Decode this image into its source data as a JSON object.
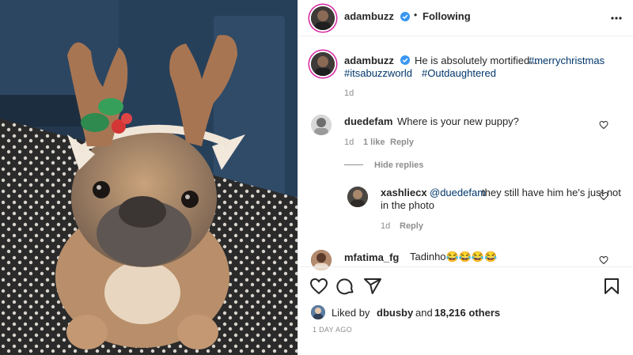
{
  "post": {
    "image_alt": "French bulldog wearing reindeer antlers headband",
    "author": "adambuzz",
    "follow_separator": "•",
    "follow_state": "Following",
    "more_icon": "more-dots-icon",
    "caption_author": "adambuzz",
    "caption_text": "He is absolutely mortified...",
    "caption_tags_line1": "#merrychristmas",
    "caption_tags_line2_a": "#itsabuzzworld",
    "caption_tags_line2_b": "#Outdaughtered",
    "caption_time": "1d"
  },
  "comments": [
    {
      "user": "duedefam",
      "text": "Where is your new puppy?",
      "time": "1d",
      "likes": "1 like",
      "reply_label": "Reply",
      "hide_replies_label": "Hide replies"
    },
    {
      "user": "xashliecx",
      "mention": "@duedefam",
      "text_line1": "they still have him he's just not",
      "text_line2": "in the photo",
      "time": "1d",
      "reply_label": "Reply"
    },
    {
      "user": "mfatima_fg",
      "text": "Tadinho😂😂😂😂"
    }
  ],
  "footer": {
    "liked_prefix": "Liked by",
    "liked_user": "dbusby",
    "liked_and": "and",
    "liked_others": "18,216 others",
    "timestamp": "1 DAY AGO"
  },
  "colors": {
    "verified": "#3897f0",
    "link": "#00376b",
    "muted": "#8e8e8e",
    "story_ring": "#d6249f"
  }
}
